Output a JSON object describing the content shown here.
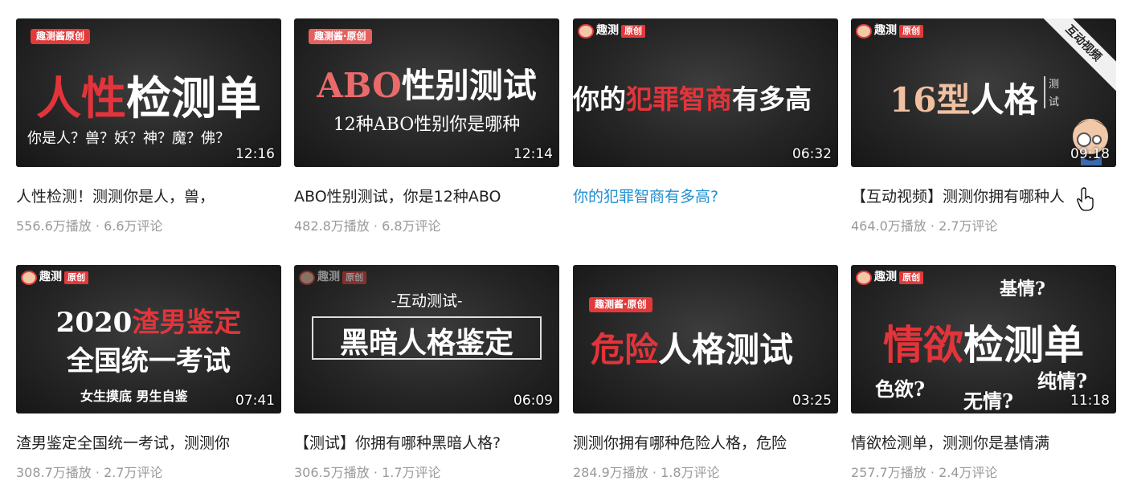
{
  "videos": [
    {
      "brand": "趣测酱原创",
      "line1_red": "人性",
      "line1_white": "检测单",
      "line2": "你是人？兽？妖？神？魔？佛？",
      "duration": "12:16",
      "title": "人性检测！测测你是人，兽，",
      "plays": "556.6万播放",
      "comments": "6.6万评论"
    },
    {
      "brand": "趣测酱·原创",
      "line1_red": "ABO",
      "line1_white": "性别测试",
      "line2": "12种ABO性别你是哪种",
      "duration": "12:14",
      "title": "ABO性别测试，你是12种ABO",
      "plays": "482.8万播放",
      "comments": "6.8万评论"
    },
    {
      "brand_word": "趣测",
      "brand_tag": "原创",
      "line1_a": "你的",
      "line1_red": "犯罪智商",
      "line1_b": "有多高",
      "duration": "06:32",
      "title": "你的犯罪智商有多高?",
      "plays": "",
      "comments": ""
    },
    {
      "brand_word": "趣测",
      "brand_tag": "原创",
      "corner": "互动视频",
      "line1_red": "16型",
      "line1_white": "人格",
      "side_a": "测",
      "side_b": "试",
      "duration": "09:18",
      "title": "【互动视频】测测你拥有哪种人",
      "plays": "464.0万播放",
      "comments": "2.7万评论"
    },
    {
      "brand_word": "趣测",
      "brand_tag": "原创",
      "line1_white": "2020",
      "line1_red": "渣男鉴定",
      "line2": "全国统一考试",
      "line3": "女生摸底 男生自鉴",
      "duration": "07:41",
      "title": "渣男鉴定全国统一考试，测测你",
      "plays": "308.7万播放",
      "comments": "2.7万评论"
    },
    {
      "brand_word": "趣测",
      "brand_tag": "原创",
      "top_text": "-互动测试-",
      "line1_white": "黑暗人格鉴定",
      "duration": "06:09",
      "title": "【测试】你拥有哪种黑暗人格?",
      "plays": "306.5万播放",
      "comments": "1.7万评论"
    },
    {
      "brand": "趣测酱·原创",
      "line1_red": "危险",
      "line1_white": "人格测试",
      "duration": "03:25",
      "title": "测测你拥有哪种危险人格，危险",
      "plays": "284.9万播放",
      "comments": "1.8万评论"
    },
    {
      "brand_word": "趣测",
      "brand_tag": "原创",
      "w_top": "基情?",
      "line1_red": "情欲",
      "line1_white": "检测单",
      "w_left": "色欲?",
      "w_mid": "无情?",
      "w_right": "纯情?",
      "duration": "11:18",
      "title": "情欲检测单，测测你是基情满",
      "plays": "257.7万播放",
      "comments": "2.4万评论"
    }
  ],
  "separator": " · ",
  "icons": {
    "mascot": "mascot-icon",
    "cursor": "hand-cursor-icon"
  }
}
